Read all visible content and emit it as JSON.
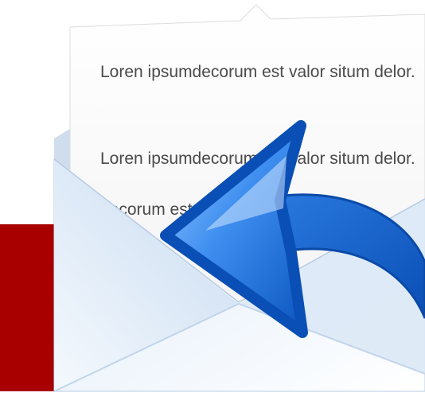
{
  "icon": {
    "name": "mail-reply-icon",
    "colors": {
      "accent_red": "#a80000",
      "arrow_blue": "#0a57c2",
      "arrow_light": "#6fb1ff",
      "envelope": "#e4eef8",
      "paper": "#fbfbfb",
      "text": "#4a4a4a"
    }
  },
  "letter": {
    "paragraph_1": "Loren ipsumdecorum est valor situm delor.",
    "paragraph_2": "Loren ipsumdecorum est valor situm delor.",
    "paragraph_3_fragment": "decorum est"
  }
}
